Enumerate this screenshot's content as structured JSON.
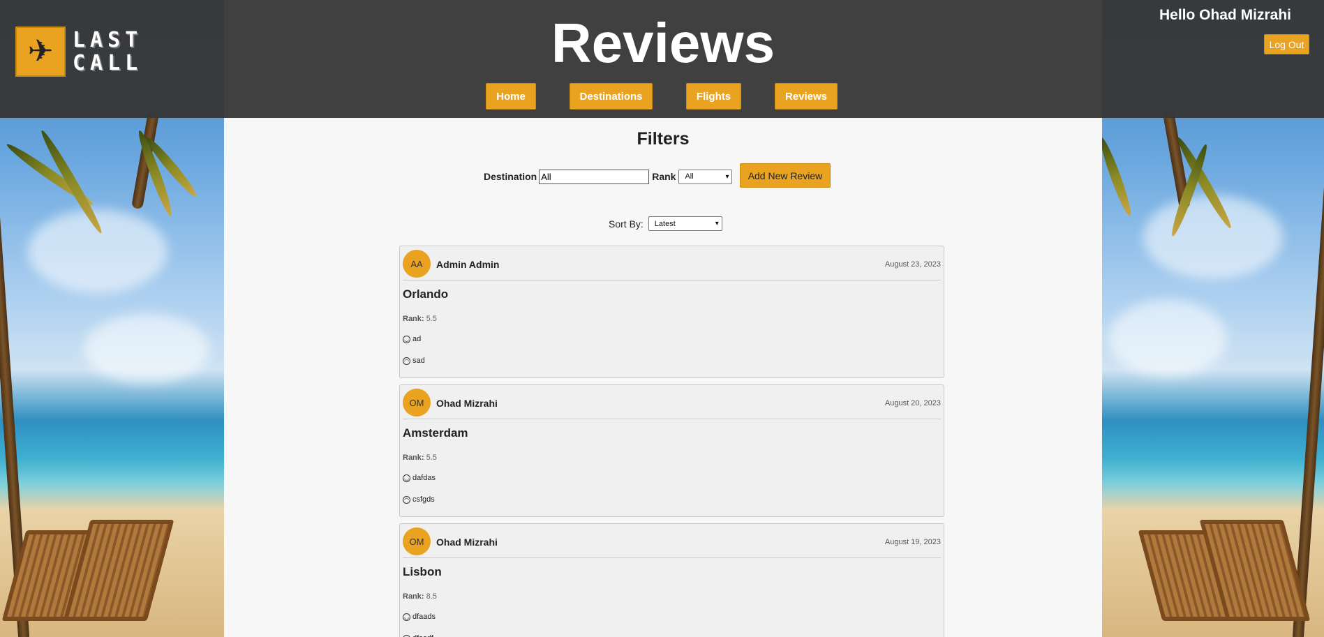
{
  "header": {
    "logo_text_line1": "LAST",
    "logo_text_line2": "CALL",
    "title": "Reviews",
    "greeting": "Hello Ohad Mizrahi",
    "logout_label": "Log Out",
    "nav": [
      "Home",
      "Destinations",
      "Flights",
      "Reviews"
    ]
  },
  "filters": {
    "title": "Filters",
    "destination_label": "Destination",
    "destination_value": "All",
    "rank_label": "Rank",
    "rank_value": "All",
    "add_review_label": "Add New Review",
    "sort_label": "Sort By:",
    "sort_value": "Latest"
  },
  "reviews": [
    {
      "initials": "AA",
      "author": "Admin Admin",
      "date": "August 23, 2023",
      "destination": "Orlando",
      "rank_label": "Rank:",
      "rank": "5.5",
      "positive": "ad",
      "negative": "sad"
    },
    {
      "initials": "OM",
      "author": "Ohad Mizrahi",
      "date": "August 20, 2023",
      "destination": "Amsterdam",
      "rank_label": "Rank:",
      "rank": "5.5",
      "positive": "dafdas",
      "negative": "csfgds"
    },
    {
      "initials": "OM",
      "author": "Ohad Mizrahi",
      "date": "August 19, 2023",
      "destination": "Lisbon",
      "rank_label": "Rank:",
      "rank": "8.5",
      "positive": "dfaads",
      "negative": "dfasdf"
    }
  ],
  "icons": {
    "positive": "smile-icon",
    "negative": "frown-icon",
    "logo": "airplane-icon"
  },
  "colors": {
    "accent": "#e9a320",
    "header": "#404040",
    "background": "#f7f7f7"
  }
}
